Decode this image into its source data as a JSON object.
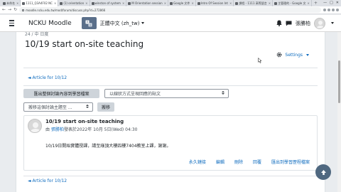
{
  "browser": {
    "tabs": [
      {
        "label": "未命名",
        "active": false
      },
      {
        "label": "1111_Q3A4F02 NC",
        "active": true
      },
      {
        "label": "(1) orientation",
        "active": false
      },
      {
        "label": "winston of system",
        "active": false
      },
      {
        "label": "M Orientation session",
        "active": false
      },
      {
        "label": "Google 文件",
        "active": false
      },
      {
        "label": "Intro Of Session Int",
        "active": false
      },
      {
        "label": "課程 - 1111 高等語言",
        "active": false
      },
      {
        "label": "主管理的 - Google 文",
        "active": false
      }
    ],
    "new_tab": "+",
    "window_controls": [
      "—",
      "□",
      "✕"
    ],
    "url": "moodle.ncku.edu.tw/mod/forum/discuss.php?d=272866"
  },
  "navbar": {
    "brand": "NCKU Moodle",
    "language": "正體中文 (zh_tw)",
    "username": "張勝柏"
  },
  "page": {
    "breadcrumb_peek": "24 / 中 日度",
    "title": "10/19 start on-site teaching",
    "settings_label": "Settings",
    "article_link_top": "◄ Article for 10/12",
    "article_link_bottom": "◄ Article for 10/12",
    "export_button": "匯出整個討論內容到學習檔案",
    "display_mode": "以線狀方式呈現回應的貼文",
    "move_select": "搬移這個討論主題至 ...",
    "move_button": "搬移"
  },
  "post": {
    "subject": "10/19 start on-site teaching",
    "byline_prefix": "由",
    "author": "張勝柏",
    "byline_suffix": "發表於2022年 10月 5日(Wed) 04:30",
    "body": "10/19日開始實體授課，請至綠頂大樓四樓7404教室上課，謝謝。",
    "commands": [
      "永久鏈接",
      "編輯",
      "刪除",
      "回覆",
      "匯出到學習歷程檔案"
    ]
  },
  "colors": {
    "link": "#0f6cbf",
    "lang_button": "#5a6f8a",
    "back_to_top": "#4f6880"
  },
  "icons": [
    "hamburger-icon",
    "translate-icon",
    "bell-icon",
    "chat-icon",
    "gear-icon",
    "arrow-up-icon"
  ]
}
